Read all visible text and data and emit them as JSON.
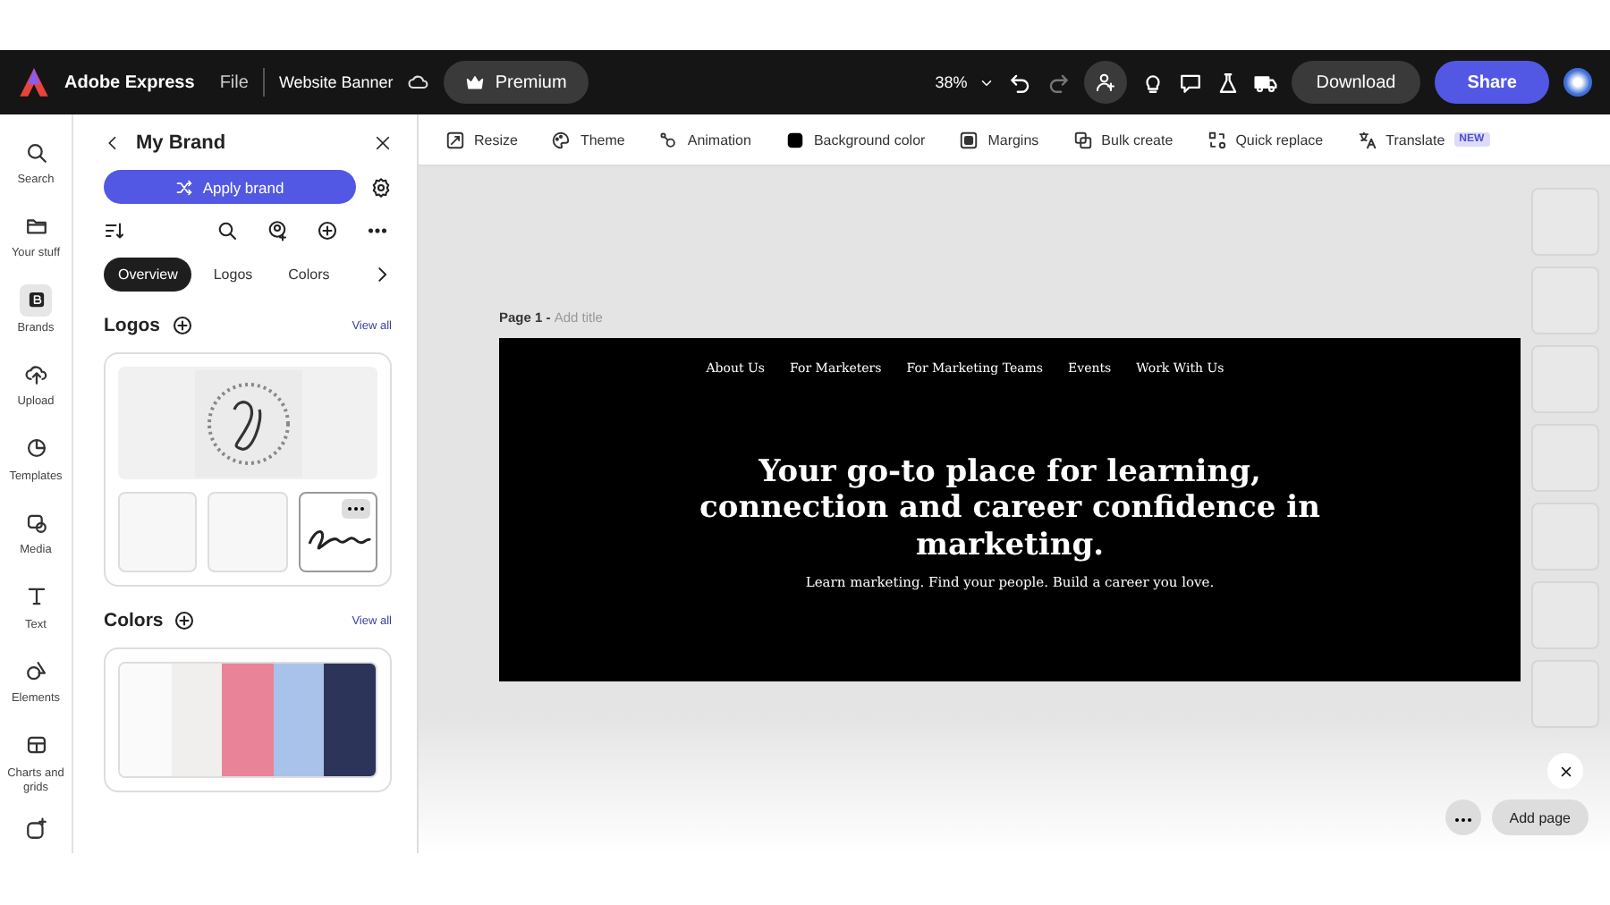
{
  "top_bar": {
    "app_name": "Adobe Express",
    "menu": "File",
    "document_title": "Website Banner",
    "premium": "Premium",
    "zoom": "38%",
    "download": "Download",
    "share": "Share"
  },
  "toolbar": {
    "items": [
      {
        "label": "Resize"
      },
      {
        "label": "Theme"
      },
      {
        "label": "Animation"
      },
      {
        "label": "Background color"
      },
      {
        "label": "Margins"
      },
      {
        "label": "Bulk create"
      },
      {
        "label": "Quick replace"
      },
      {
        "label": "Translate",
        "badge": "NEW"
      }
    ]
  },
  "left_rail": {
    "items": [
      {
        "label": "Search",
        "selected": false
      },
      {
        "label": "Your stuff",
        "selected": false
      },
      {
        "label": "Brands",
        "selected": true
      },
      {
        "label": "Upload",
        "selected": false
      },
      {
        "label": "Templates",
        "selected": false
      },
      {
        "label": "Media",
        "selected": false
      },
      {
        "label": "Text",
        "selected": false
      },
      {
        "label": "Elements",
        "selected": false
      },
      {
        "label": "Charts and grids",
        "selected": false
      }
    ]
  },
  "panel": {
    "title": "My Brand",
    "apply_button": "Apply brand",
    "tabs": [
      {
        "label": "Overview",
        "selected": true
      },
      {
        "label": "Logos",
        "selected": false
      },
      {
        "label": "Colors",
        "selected": false
      }
    ],
    "logos": {
      "title": "Logos",
      "view_all": "View all"
    },
    "colors": {
      "title": "Colors",
      "view_all": "View all",
      "swatches": [
        {
          "color": "#fafafa"
        },
        {
          "color": "#f0efed"
        },
        {
          "color": "#e98398"
        },
        {
          "color": "#a9c2ea"
        },
        {
          "color": "#2c3459"
        }
      ]
    }
  },
  "canvas": {
    "page_label": "Page 1 -",
    "title_placeholder": "Add title",
    "banner": {
      "nav": [
        "About Us",
        "For Marketers",
        "For Marketing Teams",
        "Events",
        "Work With Us"
      ],
      "headline": "Your go-to place for learning, connection and career confidence in marketing.",
      "subtext": "Learn marketing. Find your people. Build a career you love."
    },
    "add_page": "Add page"
  }
}
